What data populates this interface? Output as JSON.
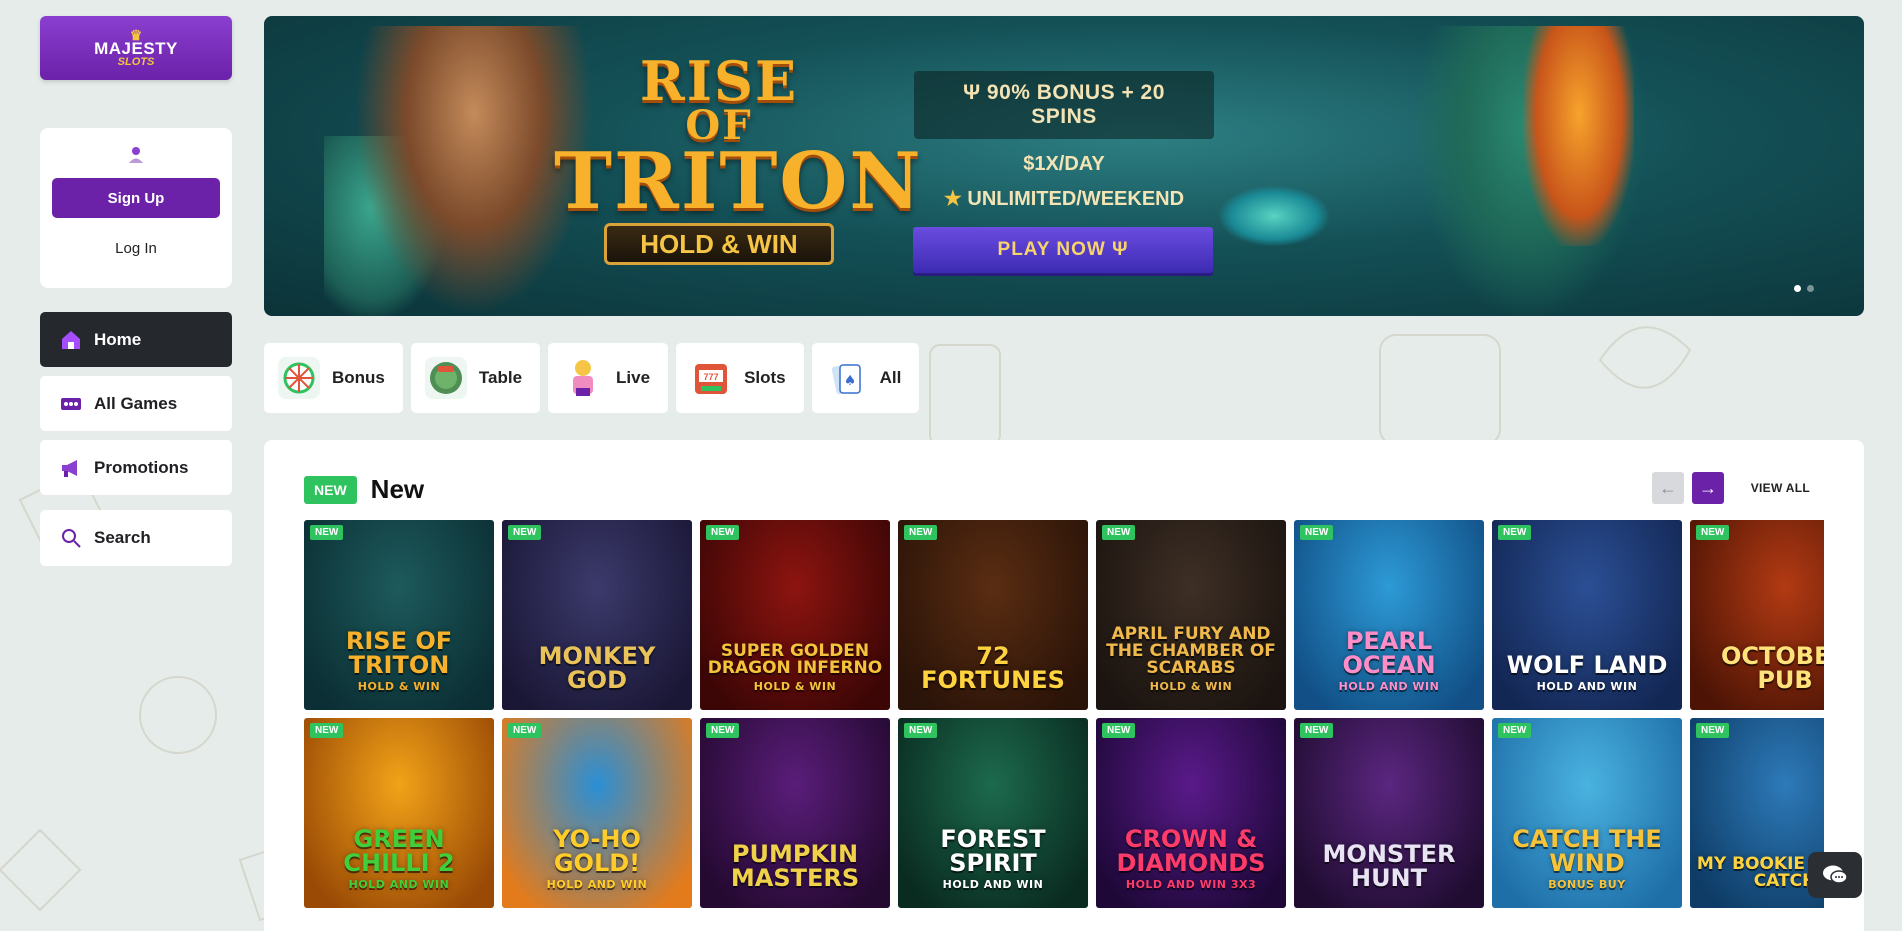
{
  "brand": {
    "line1": "MAJESTY",
    "line2": "SLOTS"
  },
  "user": {
    "signup_label": "Sign Up",
    "login_label": "Log In"
  },
  "nav": [
    {
      "label": "Home",
      "icon": "home-icon",
      "active": true
    },
    {
      "label": "All Games",
      "icon": "dice-icon",
      "active": false
    },
    {
      "label": "Promotions",
      "icon": "megaphone-icon",
      "active": false
    }
  ],
  "search": {
    "label": "Search"
  },
  "banner": {
    "title_line1": "RISE",
    "title_line2": "OF",
    "title_line3": "TRITON",
    "title_badge": "HOLD & WIN",
    "bonus": "90% BONUS + 20 SPINS",
    "line1": "1X/DAY",
    "line2": "UNLIMITED/WEEKEND",
    "cta": "PLAY NOW"
  },
  "categories": [
    {
      "label": "Bonus",
      "icon": "wheel-icon"
    },
    {
      "label": "Table",
      "icon": "table-icon"
    },
    {
      "label": "Live",
      "icon": "dealer-icon"
    },
    {
      "label": "Slots",
      "icon": "slot-machine-icon"
    },
    {
      "label": "All",
      "icon": "cards-icon"
    }
  ],
  "section": {
    "badge": "NEW",
    "title": "New",
    "view_all": "VIEW ALL"
  },
  "games": [
    {
      "name": "Rise of Triton",
      "sub": "HOLD & WIN",
      "badge": "NEW",
      "bg": "#1d5a5c",
      "bg2": "#0b2f34",
      "fg": "#f7b12a"
    },
    {
      "name": "Monkey God",
      "sub": "",
      "badge": "NEW",
      "bg": "#3b3a6b",
      "bg2": "#1a1736",
      "fg": "#e9c35a"
    },
    {
      "name": "Super Golden Dragon Inferno",
      "sub": "HOLD & WIN",
      "badge": "NEW",
      "bg": "#8d1410",
      "bg2": "#3b0605",
      "fg": "#f4c33b"
    },
    {
      "name": "72 Fortunes",
      "sub": "",
      "badge": "NEW",
      "bg": "#5a2d12",
      "bg2": "#2a1308",
      "fg": "#ffd23f"
    },
    {
      "name": "April Fury and the Chamber of Scarabs",
      "sub": "HOLD & WIN",
      "badge": "NEW",
      "bg": "#3e2f25",
      "bg2": "#1b1410",
      "fg": "#f0b94c"
    },
    {
      "name": "Pearl Ocean",
      "sub": "HOLD AND WIN",
      "badge": "NEW",
      "bg": "#2d9ad6",
      "bg2": "#114f86",
      "fg": "#ff8ec8"
    },
    {
      "name": "Wolf Land",
      "sub": "HOLD AND WIN",
      "badge": "NEW",
      "bg": "#2b4f95",
      "bg2": "#132754",
      "fg": "#ffffff"
    },
    {
      "name": "October Pub",
      "sub": "",
      "badge": "NEW",
      "bg": "#b23a13",
      "bg2": "#4d1405",
      "fg": "#ffe27a"
    },
    {
      "name": "Green Chilli 2",
      "sub": "HOLD AND WIN",
      "badge": "NEW",
      "bg": "#f2a318",
      "bg2": "#9a4a05",
      "fg": "#3fcf3a"
    },
    {
      "name": "Yo-Ho Gold!",
      "sub": "HOLD AND WIN",
      "badge": "NEW",
      "bg": "#2a8fd6",
      "bg2": "#e37b1c",
      "fg": "#ffcc2a"
    },
    {
      "name": "Pumpkin Masters",
      "sub": "",
      "badge": "NEW",
      "bg": "#5a1d7a",
      "bg2": "#240930",
      "fg": "#f0d24a"
    },
    {
      "name": "Forest Spirit",
      "sub": "HOLD AND WIN",
      "badge": "NEW",
      "bg": "#1c6a4d",
      "bg2": "#0a2b20",
      "fg": "#ffffff"
    },
    {
      "name": "Crown & Diamonds",
      "sub": "HOLD AND WIN 3x3",
      "badge": "NEW",
      "bg": "#5a1a8a",
      "bg2": "#1e0838",
      "fg": "#ff3b6a"
    },
    {
      "name": "Monster Hunt",
      "sub": "",
      "badge": "NEW",
      "bg": "#5b2680",
      "bg2": "#1f0c30",
      "fg": "#e9e4f3"
    },
    {
      "name": "Catch the Wind",
      "sub": "Bonus Buy",
      "badge": "NEW",
      "bg": "#4ab3e0",
      "bg2": "#1e6ea8",
      "fg": "#f6c33a"
    },
    {
      "name": "My Bookie Great Catch",
      "sub": "",
      "badge": "NEW",
      "bg": "#2d7ab9",
      "bg2": "#0e3c66",
      "fg": "#ffd23f"
    }
  ],
  "colors": {
    "accent": "#6b21a8",
    "new_green": "#2fc35f",
    "bg": "#e6ecea",
    "dark": "#25292e"
  }
}
